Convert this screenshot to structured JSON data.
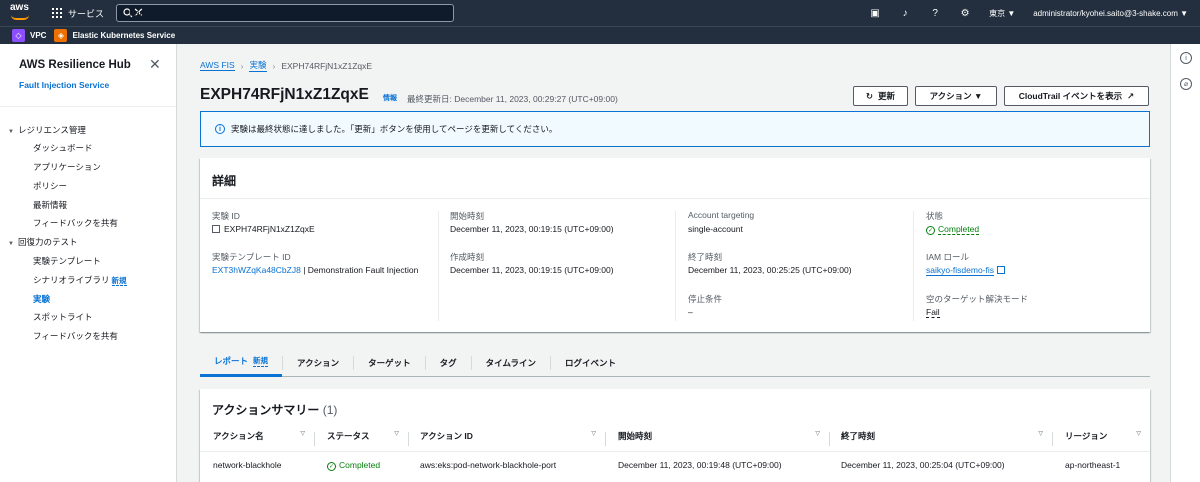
{
  "topnav": {
    "logo": "aws",
    "services_label": "サービス",
    "search_value": "Fault",
    "region": "東京 ▼",
    "account": "administrator/kyohei.saito@3-shake.com ▼"
  },
  "favorites": [
    {
      "label": "VPC",
      "color": "#8c4fff"
    },
    {
      "label": "Elastic Kubernetes Service",
      "color": "#ed7100"
    }
  ],
  "sidebar": {
    "title": "AWS Resilience Hub",
    "subtitle": "Fault Injection Service",
    "section1": "レジリエンス管理",
    "items1": [
      "ダッシュボード",
      "アプリケーション",
      "ポリシー",
      "最新情報",
      "フィードバックを共有"
    ],
    "section2": "回復力のテスト",
    "items2": [
      "実験テンプレート",
      "シナリオライブラリ",
      "実験",
      "スポットライト",
      "フィードバックを共有"
    ],
    "new_badge": "新規"
  },
  "breadcrumb": {
    "b1": "AWS FIS",
    "b2": "実験",
    "b3": "EXPH74RFjN1xZ1ZqxE"
  },
  "header": {
    "title": "EXPH74RFjN1xZ1ZqxE",
    "info": "情報",
    "last_updated": "最終更新日: December 11, 2023, 00:29:27 (UTC+09:00)",
    "refresh_btn": "更新",
    "action_btn": "アクション ▼",
    "cloudtrail_btn": "CloudTrail イベントを表示"
  },
  "alert": {
    "text": "実験は最終状態に達しました。「更新」ボタンを使用してページを更新してください。"
  },
  "details": {
    "title": "詳細",
    "exp_id_label": "実験 ID",
    "exp_id": "EXPH74RFjN1xZ1ZqxE",
    "tpl_label": "実験テンプレート ID",
    "tpl_link": "EXT3hWZqKa48CbZJ8",
    "tpl_rest": " | Demonstration Fault Injection",
    "start_label": "開始時刻",
    "start": "December 11, 2023, 00:19:15 (UTC+09:00)",
    "created_label": "作成時刻",
    "created": "December 11, 2023, 00:19:15 (UTC+09:00)",
    "targeting_label": "Account targeting",
    "targeting": "single-account",
    "end_label": "終了時刻",
    "end": "December 11, 2023, 00:25:25 (UTC+09:00)",
    "stop_label": "停止条件",
    "stop": "–",
    "state_label": "状態",
    "state": "Completed",
    "iam_label": "IAM ロール",
    "iam": "saikyo-fisdemo-fis",
    "empty_label": "空のターゲット解決モード",
    "empty": "Fail"
  },
  "tabs": [
    "レポート",
    "アクション",
    "ターゲット",
    "タグ",
    "タイムライン",
    "ログイベント"
  ],
  "actions": {
    "title": "アクションサマリー",
    "count": "(1)",
    "headers": [
      "アクション名",
      "ステータス",
      "アクション ID",
      "開始時刻",
      "終了時刻",
      "リージョン"
    ],
    "row": [
      "network-blackhole",
      "Completed",
      "aws:eks:pod-network-blackhole-port",
      "December 11, 2023, 00:19:48 (UTC+09:00)",
      "December 11, 2023, 00:25:04 (UTC+09:00)",
      "ap-northeast-1"
    ]
  }
}
